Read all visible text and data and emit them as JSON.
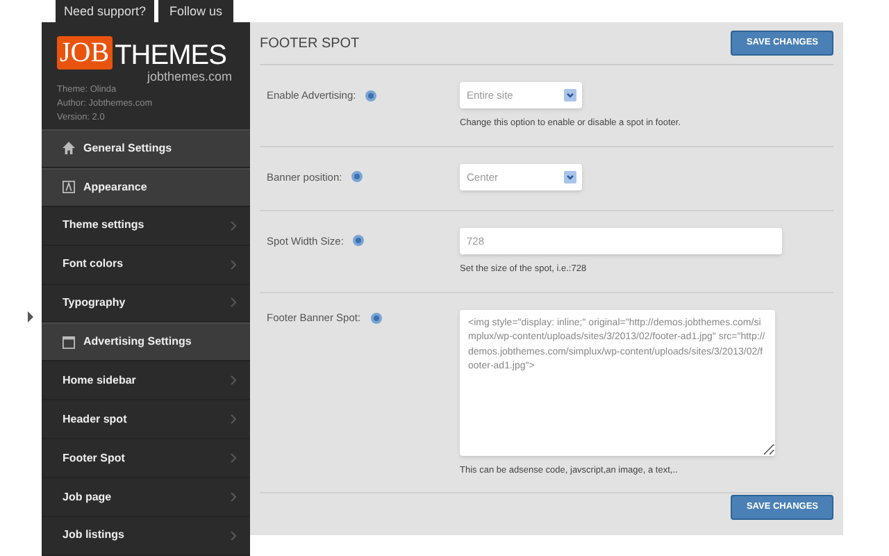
{
  "top_tabs": [
    "Need support?",
    "Follow us"
  ],
  "logo": {
    "part_1": "JOB",
    "part_2": "THEMES",
    "url": "jobthemes.com"
  },
  "theme_info": [
    "Theme: Olinda",
    "Author: Jobthemes.com",
    "Version: 2.0"
  ],
  "sidebar": {
    "items": [
      {
        "kind": "section",
        "label": "General Settings"
      },
      {
        "kind": "section",
        "label": "Appearance"
      },
      {
        "kind": "item",
        "label": "Theme settings"
      },
      {
        "kind": "item",
        "label": "Font colors"
      },
      {
        "kind": "item",
        "label": "Typography"
      },
      {
        "kind": "section",
        "label": "Advertising Settings"
      },
      {
        "kind": "item",
        "label": "Home sidebar"
      },
      {
        "kind": "item",
        "label": "Header spot"
      },
      {
        "kind": "item",
        "label": "Footer Spot"
      },
      {
        "kind": "item",
        "label": "Job page"
      },
      {
        "kind": "item",
        "label": "Job listings"
      }
    ]
  },
  "panel": {
    "title": "FOOTER SPOT",
    "save_button": "SAVE CHANGES",
    "fields": [
      {
        "kind": "select",
        "label": "Enable Advertising:",
        "value": "Entire site",
        "help": "Change this option to enable or disable a spot in footer."
      },
      {
        "kind": "select",
        "label": "Banner position:",
        "value": "Center"
      },
      {
        "kind": "text",
        "label": "Spot Width Size:",
        "value": "728",
        "help": "Set the size of the spot, i.e.:728"
      },
      {
        "kind": "textarea",
        "label": "Footer Banner Spot:",
        "value": "<img style=\"display: inline;\" original=\"http://demos.jobthemes.com/simplux/wp-content/uploads/sites/3/2013/02/footer-ad1.jpg\" src=\"http://demos.jobthemes.com/simplux/wp-content/uploads/sites/3/2013/02/footer-ad1.jpg\">",
        "help": "This can be adsense code, javscript,an image, a text,.."
      }
    ],
    "bottom_button": "SAVE CHANGES"
  }
}
